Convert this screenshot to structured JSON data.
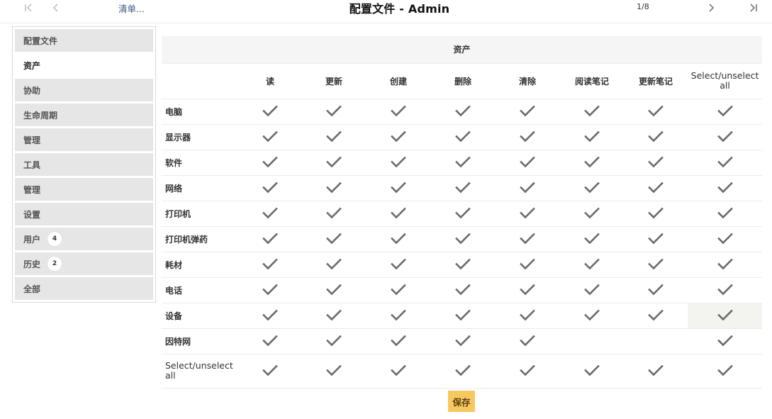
{
  "header": {
    "list_link": "清单...",
    "title": "配置文件 - Admin",
    "counter": "1/8",
    "nav_icons": [
      "first-page-icon",
      "previous-page-icon",
      "next-page-icon",
      "last-page-icon"
    ]
  },
  "sidebar": {
    "tabs": [
      {
        "label": "配置文件",
        "badge": null,
        "active": false
      },
      {
        "label": "资产",
        "badge": null,
        "active": true
      },
      {
        "label": "协助",
        "badge": null,
        "active": false
      },
      {
        "label": "生命周期",
        "badge": null,
        "active": false
      },
      {
        "label": "管理",
        "badge": null,
        "active": false
      },
      {
        "label": "工具",
        "badge": null,
        "active": false
      },
      {
        "label": "管理",
        "badge": null,
        "active": false
      },
      {
        "label": "设置",
        "badge": null,
        "active": false
      },
      {
        "label": "用户",
        "badge": "4",
        "active": false
      },
      {
        "label": "历史",
        "badge": "2",
        "active": false
      },
      {
        "label": "全部",
        "badge": null,
        "active": false
      }
    ]
  },
  "rights": {
    "group_title": "资产",
    "columns": [
      "读",
      "更新",
      "创建",
      "删除",
      "清除",
      "阅读笔记",
      "更新笔记",
      "Select/unselect all"
    ],
    "rows": [
      {
        "label": "电脑",
        "checks": [
          true,
          true,
          true,
          true,
          true,
          true,
          true,
          true
        ]
      },
      {
        "label": "显示器",
        "checks": [
          true,
          true,
          true,
          true,
          true,
          true,
          true,
          true
        ]
      },
      {
        "label": "软件",
        "checks": [
          true,
          true,
          true,
          true,
          true,
          true,
          true,
          true
        ]
      },
      {
        "label": "网络",
        "checks": [
          true,
          true,
          true,
          true,
          true,
          true,
          true,
          true
        ]
      },
      {
        "label": "打印机",
        "checks": [
          true,
          true,
          true,
          true,
          true,
          true,
          true,
          true
        ]
      },
      {
        "label": "打印机弹药",
        "checks": [
          true,
          true,
          true,
          true,
          true,
          true,
          true,
          true
        ]
      },
      {
        "label": "耗材",
        "checks": [
          true,
          true,
          true,
          true,
          true,
          true,
          true,
          true
        ]
      },
      {
        "label": "电话",
        "checks": [
          true,
          true,
          true,
          true,
          true,
          true,
          true,
          true
        ]
      },
      {
        "label": "设备",
        "checks": [
          true,
          true,
          true,
          true,
          true,
          true,
          true,
          true
        ]
      },
      {
        "label": "因特网",
        "checks": [
          true,
          true,
          true,
          true,
          true,
          false,
          false,
          true
        ]
      }
    ],
    "select_all_row_label": "Select/unselect all",
    "select_all_checks": [
      true,
      true,
      true,
      true,
      true,
      true,
      true,
      true
    ]
  },
  "save_label": "保存",
  "colors": {
    "accent_save": "#f8c860",
    "link": "#3a5384",
    "tab_bg": "#e6e6e6",
    "check": "#6b6b6b"
  }
}
